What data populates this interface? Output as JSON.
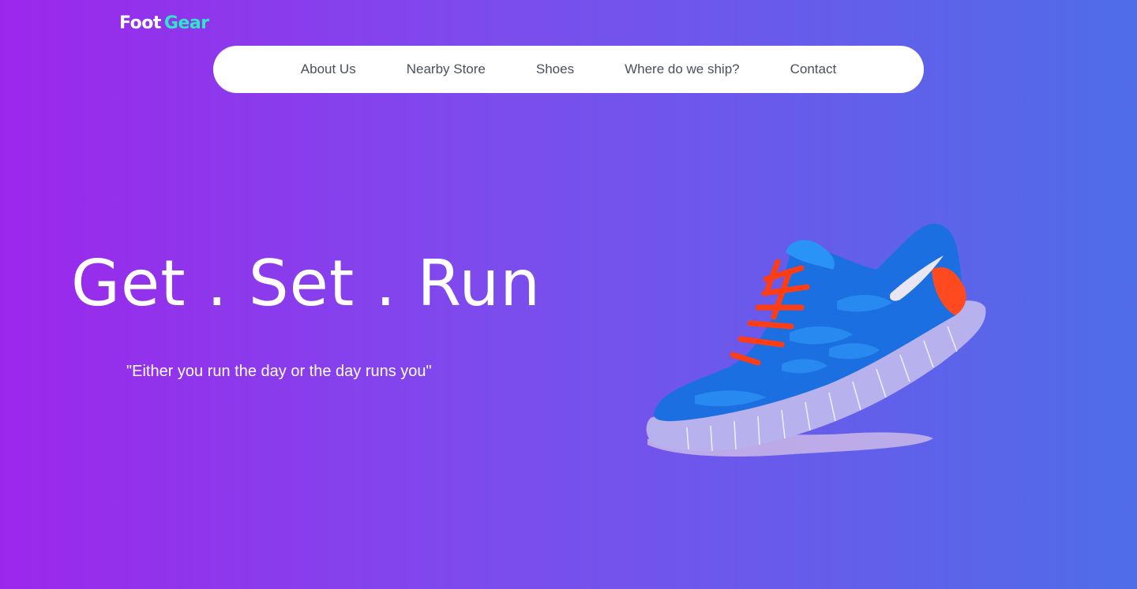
{
  "brand": {
    "part1": "Foot",
    "part2": "Gear"
  },
  "nav": {
    "items": [
      {
        "label": "About Us"
      },
      {
        "label": "Nearby Store"
      },
      {
        "label": "Shoes"
      },
      {
        "label": "Where do we ship?"
      },
      {
        "label": "Contact"
      }
    ]
  },
  "hero": {
    "title": "Get . Set . Run",
    "quote": "\"Either you run the day or the day runs you\"",
    "image_icon": "running-shoe-image"
  },
  "colors": {
    "gradient_start": "#9c27ec",
    "gradient_end": "#4f6de8",
    "brand_accent": "#2ee6c8",
    "nav_background": "#ffffff",
    "nav_text": "#4a4f5c",
    "shoe_blue": "#1c6fe0",
    "shoe_laces": "#ff3d14"
  }
}
